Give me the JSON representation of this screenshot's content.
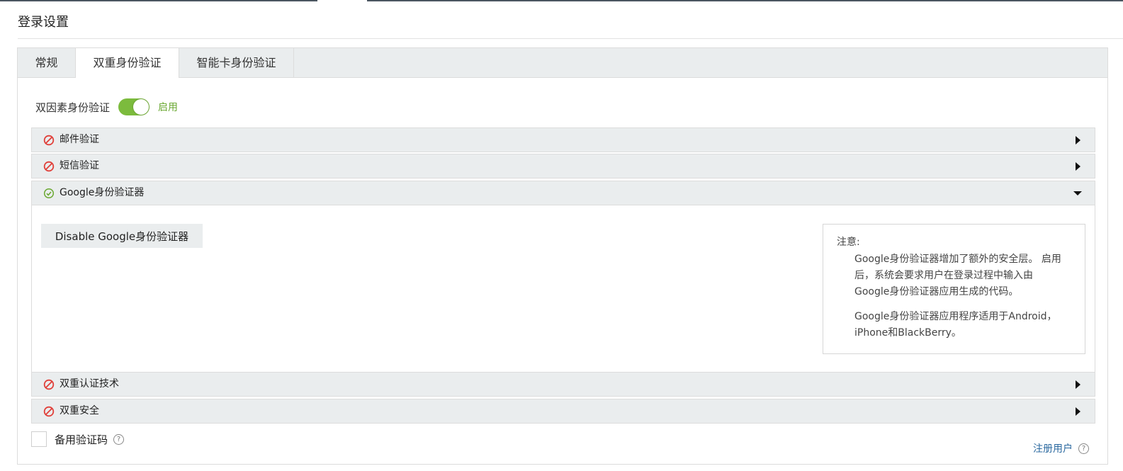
{
  "page": {
    "title": "登录设置"
  },
  "tabs": [
    {
      "label": "常规"
    },
    {
      "label": "双重身份验证"
    },
    {
      "label": "智能卡身份验证"
    }
  ],
  "tfa": {
    "label": "双因素身份验证",
    "state": "启用",
    "enabled": true
  },
  "methods": [
    {
      "label": "邮件验证",
      "status": "disabled",
      "expanded": false
    },
    {
      "label": "短信验证",
      "status": "disabled",
      "expanded": false
    },
    {
      "label": "Google身份验证器",
      "status": "enabled",
      "expanded": true
    },
    {
      "label": "双重认证技术",
      "status": "disabled",
      "expanded": false
    },
    {
      "label": "双重安全",
      "status": "disabled",
      "expanded": false
    }
  ],
  "google": {
    "disable_button": "Disable Google身份验证器",
    "note": {
      "title": "注意:",
      "p1": "Google身份验证器增加了额外的安全层。 启用后，系统会要求用户在登录过程中输入由Google身份验证器应用生成的代码。",
      "p2": "Google身份验证器应用程序适用于Android，iPhone和BlackBerry。"
    }
  },
  "backup": {
    "label": "备用验证码"
  },
  "register": {
    "label": "注册用户"
  },
  "colors": {
    "accent_green": "#7cbb3d",
    "disabled_red": "#e0403a",
    "link_blue": "#2c6aa0"
  }
}
